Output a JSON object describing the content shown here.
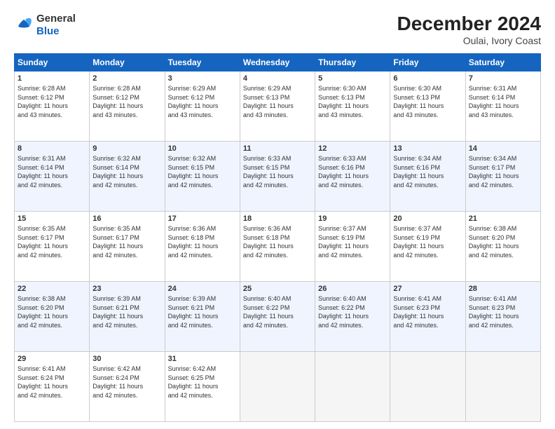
{
  "logo": {
    "line1": "General",
    "line2": "Blue"
  },
  "title": "December 2024",
  "subtitle": "Oulai, Ivory Coast",
  "headers": [
    "Sunday",
    "Monday",
    "Tuesday",
    "Wednesday",
    "Thursday",
    "Friday",
    "Saturday"
  ],
  "weeks": [
    [
      {
        "day": "1",
        "rise": "6:28 AM",
        "set": "6:12 PM",
        "hours": "11",
        "mins": "43"
      },
      {
        "day": "2",
        "rise": "6:28 AM",
        "set": "6:12 PM",
        "hours": "11",
        "mins": "43"
      },
      {
        "day": "3",
        "rise": "6:29 AM",
        "set": "6:12 PM",
        "hours": "11",
        "mins": "43"
      },
      {
        "day": "4",
        "rise": "6:29 AM",
        "set": "6:13 PM",
        "hours": "11",
        "mins": "43"
      },
      {
        "day": "5",
        "rise": "6:30 AM",
        "set": "6:13 PM",
        "hours": "11",
        "mins": "43"
      },
      {
        "day": "6",
        "rise": "6:30 AM",
        "set": "6:13 PM",
        "hours": "11",
        "mins": "43"
      },
      {
        "day": "7",
        "rise": "6:31 AM",
        "set": "6:14 PM",
        "hours": "11",
        "mins": "43"
      }
    ],
    [
      {
        "day": "8",
        "rise": "6:31 AM",
        "set": "6:14 PM",
        "hours": "11",
        "mins": "42"
      },
      {
        "day": "9",
        "rise": "6:32 AM",
        "set": "6:14 PM",
        "hours": "11",
        "mins": "42"
      },
      {
        "day": "10",
        "rise": "6:32 AM",
        "set": "6:15 PM",
        "hours": "11",
        "mins": "42"
      },
      {
        "day": "11",
        "rise": "6:33 AM",
        "set": "6:15 PM",
        "hours": "11",
        "mins": "42"
      },
      {
        "day": "12",
        "rise": "6:33 AM",
        "set": "6:16 PM",
        "hours": "11",
        "mins": "42"
      },
      {
        "day": "13",
        "rise": "6:34 AM",
        "set": "6:16 PM",
        "hours": "11",
        "mins": "42"
      },
      {
        "day": "14",
        "rise": "6:34 AM",
        "set": "6:17 PM",
        "hours": "11",
        "mins": "42"
      }
    ],
    [
      {
        "day": "15",
        "rise": "6:35 AM",
        "set": "6:17 PM",
        "hours": "11",
        "mins": "42"
      },
      {
        "day": "16",
        "rise": "6:35 AM",
        "set": "6:17 PM",
        "hours": "11",
        "mins": "42"
      },
      {
        "day": "17",
        "rise": "6:36 AM",
        "set": "6:18 PM",
        "hours": "11",
        "mins": "42"
      },
      {
        "day": "18",
        "rise": "6:36 AM",
        "set": "6:18 PM",
        "hours": "11",
        "mins": "42"
      },
      {
        "day": "19",
        "rise": "6:37 AM",
        "set": "6:19 PM",
        "hours": "11",
        "mins": "42"
      },
      {
        "day": "20",
        "rise": "6:37 AM",
        "set": "6:19 PM",
        "hours": "11",
        "mins": "42"
      },
      {
        "day": "21",
        "rise": "6:38 AM",
        "set": "6:20 PM",
        "hours": "11",
        "mins": "42"
      }
    ],
    [
      {
        "day": "22",
        "rise": "6:38 AM",
        "set": "6:20 PM",
        "hours": "11",
        "mins": "42"
      },
      {
        "day": "23",
        "rise": "6:39 AM",
        "set": "6:21 PM",
        "hours": "11",
        "mins": "42"
      },
      {
        "day": "24",
        "rise": "6:39 AM",
        "set": "6:21 PM",
        "hours": "11",
        "mins": "42"
      },
      {
        "day": "25",
        "rise": "6:40 AM",
        "set": "6:22 PM",
        "hours": "11",
        "mins": "42"
      },
      {
        "day": "26",
        "rise": "6:40 AM",
        "set": "6:22 PM",
        "hours": "11",
        "mins": "42"
      },
      {
        "day": "27",
        "rise": "6:41 AM",
        "set": "6:23 PM",
        "hours": "11",
        "mins": "42"
      },
      {
        "day": "28",
        "rise": "6:41 AM",
        "set": "6:23 PM",
        "hours": "11",
        "mins": "42"
      }
    ],
    [
      {
        "day": "29",
        "rise": "6:41 AM",
        "set": "6:24 PM",
        "hours": "11",
        "mins": "42"
      },
      {
        "day": "30",
        "rise": "6:42 AM",
        "set": "6:24 PM",
        "hours": "11",
        "mins": "42"
      },
      {
        "day": "31",
        "rise": "6:42 AM",
        "set": "6:25 PM",
        "hours": "11",
        "mins": "42"
      },
      null,
      null,
      null,
      null
    ]
  ]
}
